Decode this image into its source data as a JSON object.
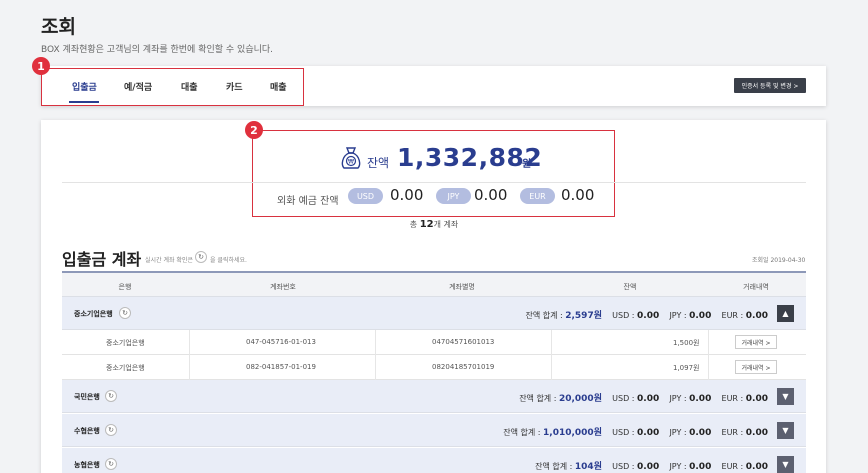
{
  "header": {
    "title": "조회",
    "subtitle": "BOX 계좌현황은 고객님의 계좌를 한번에 확인할 수 있습니다."
  },
  "tabs": [
    {
      "label": "입출금",
      "active": true
    },
    {
      "label": "예/적금",
      "active": false
    },
    {
      "label": "대출",
      "active": false
    },
    {
      "label": "카드",
      "active": false
    },
    {
      "label": "매출",
      "active": false
    }
  ],
  "cert_button": "인증서 등록 및 변경 >",
  "badges": [
    "1",
    "2"
  ],
  "balance": {
    "label": "잔액",
    "amount": "1,332,882",
    "unit": "원",
    "fx_label": "외화 예금 잔액",
    "fx": [
      {
        "currency": "USD",
        "value": "0.00"
      },
      {
        "currency": "JPY",
        "value": "0.00"
      },
      {
        "currency": "EUR",
        "value": "0.00"
      }
    ],
    "count_prefix": "총",
    "count": "12",
    "count_suffix": "개 계좌"
  },
  "section": {
    "title": "입출금 계좌",
    "hint_before": "실시간 계좌 확인은",
    "hint_after": "을 클릭하세요.",
    "date": "조회일 2019-04-30"
  },
  "table": {
    "headers": [
      "은행",
      "계좌번호",
      "계좌별명",
      "잔액",
      "거래내역"
    ],
    "groups": [
      {
        "bank": "중소기업은행",
        "sum_label": "잔액 합계 :",
        "sum": "2,597원",
        "usd_label": "USD :",
        "usd": "0.00",
        "jpy_label": "JPY :",
        "jpy": "0.00",
        "eur_label": "EUR :",
        "eur": "0.00",
        "toggle": "▲",
        "accounts": [
          {
            "bank": "중소기업은행",
            "number": "047-045716-01-013",
            "alias": "04704571601013",
            "balance": "1,500원",
            "history": "거래내역 >"
          },
          {
            "bank": "중소기업은행",
            "number": "082-041857-01-019",
            "alias": "08204185701019",
            "balance": "1,097원",
            "history": "거래내역 >"
          }
        ]
      },
      {
        "bank": "국민은행",
        "sum_label": "잔액 합계 :",
        "sum": "20,000원",
        "usd_label": "USD :",
        "usd": "0.00",
        "jpy_label": "JPY :",
        "jpy": "0.00",
        "eur_label": "EUR :",
        "eur": "0.00",
        "toggle": "▼"
      },
      {
        "bank": "수협은행",
        "sum_label": "잔액 합계 :",
        "sum": "1,010,000원",
        "usd_label": "USD :",
        "usd": "0.00",
        "jpy_label": "JPY :",
        "jpy": "0.00",
        "eur_label": "EUR :",
        "eur": "0.00",
        "toggle": "▼"
      },
      {
        "bank": "농협은행",
        "sum_label": "잔액 합계 :",
        "sum": "104원",
        "usd_label": "USD :",
        "usd": "0.00",
        "jpy_label": "JPY :",
        "jpy": "0.00",
        "eur_label": "EUR :",
        "eur": "0.00",
        "toggle": "▼"
      }
    ]
  },
  "colors": {
    "accent": "#2a3d8f",
    "highlight": "#d8323f",
    "badge": "#e0303d",
    "pill": "#b3bde0"
  }
}
